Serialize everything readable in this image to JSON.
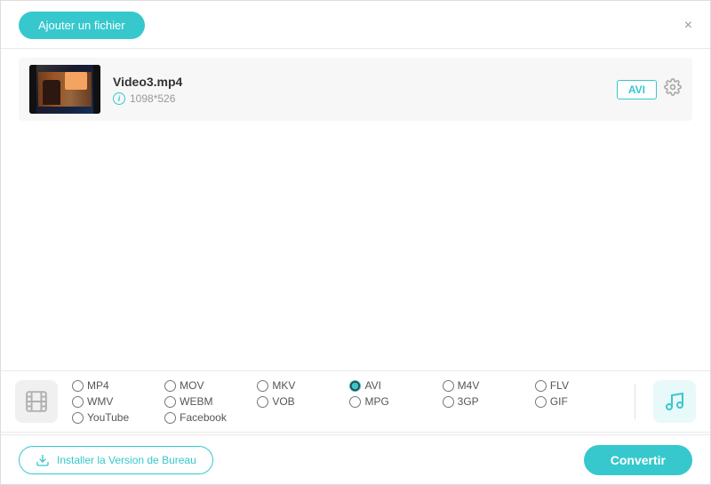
{
  "header": {
    "add_file_label": "Ajouter un fichier",
    "close_icon": "×"
  },
  "file_item": {
    "name": "Video3.mp4",
    "resolution": "1098*526",
    "format_badge": "AVI"
  },
  "format_options": {
    "video_formats": [
      {
        "id": "mp4",
        "label": "MP4",
        "checked": false,
        "row": 1
      },
      {
        "id": "mov",
        "label": "MOV",
        "checked": false,
        "row": 1
      },
      {
        "id": "mkv",
        "label": "MKV",
        "checked": false,
        "row": 1
      },
      {
        "id": "avi",
        "label": "AVI",
        "checked": true,
        "row": 1
      },
      {
        "id": "m4v",
        "label": "M4V",
        "checked": false,
        "row": 1
      },
      {
        "id": "flv",
        "label": "FLV",
        "checked": false,
        "row": 1
      },
      {
        "id": "wmv",
        "label": "WMV",
        "checked": false,
        "row": 1
      },
      {
        "id": "webm",
        "label": "WEBM",
        "checked": false,
        "row": 2
      },
      {
        "id": "vob",
        "label": "VOB",
        "checked": false,
        "row": 2
      },
      {
        "id": "mpg",
        "label": "MPG",
        "checked": false,
        "row": 2
      },
      {
        "id": "3gp",
        "label": "3GP",
        "checked": false,
        "row": 2
      },
      {
        "id": "gif",
        "label": "GIF",
        "checked": false,
        "row": 2
      },
      {
        "id": "youtube",
        "label": "YouTube",
        "checked": false,
        "row": 2
      },
      {
        "id": "facebook",
        "label": "Facebook",
        "checked": false,
        "row": 2
      }
    ]
  },
  "footer": {
    "install_label": "Installer la Version de Bureau",
    "convert_label": "Convertir"
  }
}
